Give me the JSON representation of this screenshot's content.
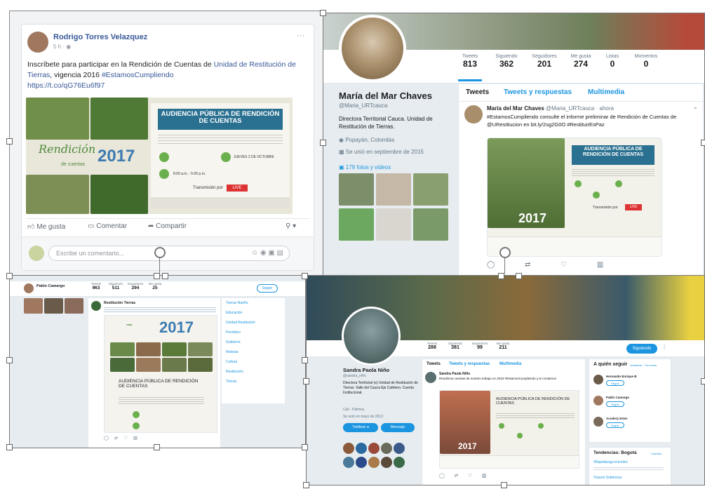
{
  "facebook": {
    "author": "Rodrigo Torres Velazquez",
    "meta": "5 h · ◉",
    "menu": "···",
    "post_text_1": "Inscríbete para participar en la Rendición de Cuentas de ",
    "post_link_1": "Unidad de Restitución de Tierras",
    "post_text_2": ", vigencia 2016 ",
    "post_hashtag": "#EstamosCumpliendo",
    "post_url": "https://t.co/qG76Eu6f97",
    "poster_title": "AUDIENCIA PÚBLICA DE RENDICIÓN DE CUENTAS",
    "poster_script": "Rendición",
    "poster_sub": "de cuentas",
    "poster_year": "2017",
    "poster_date": "JUEVES 2 DE OCTUBRE",
    "poster_time": "8:00 a.m. - 5:00 p.m.",
    "poster_broadcast": "Transmisión por",
    "poster_live": "LIVE",
    "like": "Me gusta",
    "comment": "Comentar",
    "share": "Compartir",
    "comment_placeholder": "Escribe un comentario..."
  },
  "twitter_top": {
    "name": "María del Mar Chaves",
    "handle": "@Maria_URTcauca",
    "bio": "Directora Territorial Cauca. Unidad de Restitución de Tierras.",
    "location": "Popayán, Colombia",
    "joined": "Se unió en septiembre de 2015",
    "photos_link": "179 fotos y videos",
    "stats": [
      {
        "label": "Tweets",
        "value": "813"
      },
      {
        "label": "Siguiendo",
        "value": "362"
      },
      {
        "label": "Seguidores",
        "value": "201"
      },
      {
        "label": "Me gusta",
        "value": "274"
      },
      {
        "label": "Listas",
        "value": "0"
      },
      {
        "label": "Momentos",
        "value": "0"
      }
    ],
    "tabs": [
      "Tweets",
      "Tweets y respuestas",
      "Multimedia"
    ],
    "tweet_author": "María del Mar Chaves",
    "tweet_handle": "@Maria_URTcauca · ahora",
    "tweet_text": "#EstamosCumpliendo consulte el informe preliminar de Rendición de Cuentas de @URestitucion en bit.ly/2sg2G0O #RestituirEsPaz",
    "poster_title": "AUDIENCIA PÚBLICA DE RENDICIÓN DE CUENTAS",
    "poster_year": "2017",
    "poster_broadcast": "Transmisión por",
    "poster_live": "LIVE"
  },
  "twitter_bl": {
    "name": "Pablo Camargo",
    "stats": [
      {
        "label": "Tweets",
        "value": "963"
      },
      {
        "label": "Siguiendo",
        "value": "511"
      },
      {
        "label": "Seguidores",
        "value": "294"
      },
      {
        "label": "Me gusta",
        "value": "25"
      }
    ],
    "follow": "Seguir",
    "tweet_author": "Restitución Tierras",
    "poster_year": "2017",
    "poster_title": "AUDIENCIA PÚBLICA DE RENDICIÓN DE CUENTAS",
    "side_items": [
      "Tierras Nariño",
      "Educación",
      "Unidad Restitución",
      "Periódico",
      "Gobierno",
      "Noticias",
      "Cultura",
      "Restitución",
      "Tierras"
    ]
  },
  "twitter_br": {
    "name": "Sandra Paola Niño",
    "handle": "@sandra_niño",
    "bio": "Directora Territorial (e) Unidad de Restitución de Tierras. Valle del Cauca Eje Cafetero. Cuenta Institucional.",
    "location": "Cali - Palmira",
    "joined": "Se unió en mayo de 2013",
    "stats": [
      {
        "label": "Tweets",
        "value": "288"
      },
      {
        "label": "Siguiendo",
        "value": "381"
      },
      {
        "label": "Seguidores",
        "value": "99"
      },
      {
        "label": "Me gusta",
        "value": "211"
      }
    ],
    "following_button": "Siguiendo",
    "follow_button": "Seguir",
    "tweet_to": "Twittear a",
    "message": "Mensaje",
    "tabs": [
      "Tweets",
      "Tweets y respuestas",
      "Multimedia"
    ],
    "tweet_author": "Sandra Paola Niño",
    "tweet_text": "Rendimos cuentas de nuestro trabajo en 2016 #EstamosCumpliendo y te contamos",
    "poster_title": "AUDIENCIA PÚBLICA DE RENDICIÓN DE CUENTAS",
    "poster_year": "2017",
    "who_to_follow": "A quién seguir",
    "who_links": "Actualizar · Ver todos",
    "suggestions": [
      "Hernando Enrique B",
      "Pablo Camargo",
      "Acodery Ester"
    ],
    "trends_title": "Tendencias: Bogotá",
    "trends_link": "Cambiar",
    "trend_1": "#Rapidavagi encontre",
    "trend_2": "Yosumi Sobrinoza"
  }
}
